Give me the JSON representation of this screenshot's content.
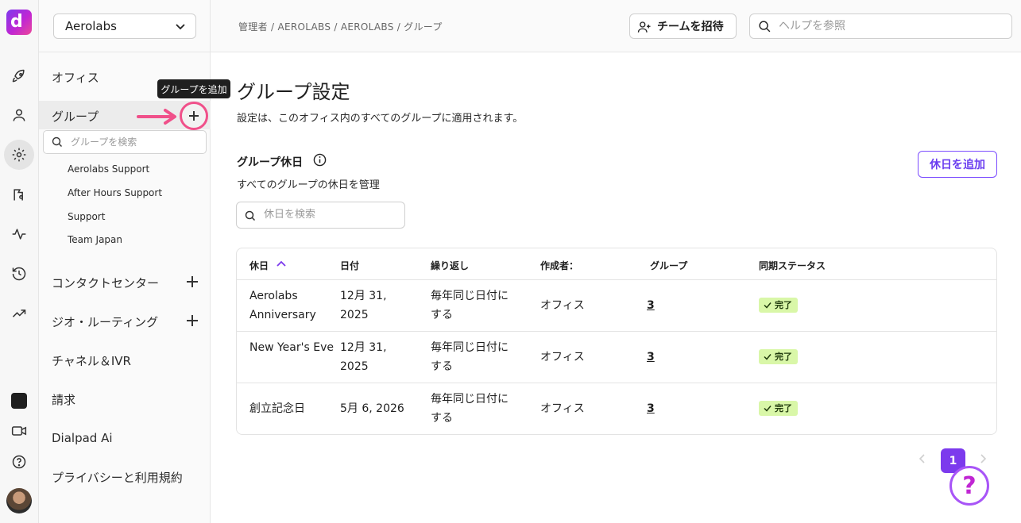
{
  "rail": {
    "logo_text": "d",
    "icons": [
      "rocket-icon",
      "person-icon",
      "gear-icon",
      "routing-icon",
      "activity-icon",
      "history-icon",
      "trending-icon",
      "dialpad-icon",
      "video-icon",
      "question-icon"
    ]
  },
  "sidebar": {
    "org": "Aerolabs",
    "items": {
      "office": "オフィス",
      "groups": "グループ",
      "contact_center": "コンタクトセンター",
      "geo_routing": "ジオ・ルーティング",
      "channels_ivr": "チャネル＆IVR",
      "billing": "請求",
      "dialpad_ai": "Dialpad Ai",
      "privacy": "プライバシーと利用規約"
    },
    "group_search_placeholder": "グループを検索",
    "groups_list": [
      "Aerolabs Support",
      "After Hours Support",
      "Support",
      "Team Japan"
    ],
    "tooltip": "グループを追加"
  },
  "topbar": {
    "breadcrumb": "管理者 / AEROLABS / AEROLABS / グループ",
    "invite_label": "チームを招待",
    "help_placeholder": "ヘルプを参照"
  },
  "main": {
    "title": "グループ設定",
    "subtitle": "設定は、このオフィス内のすべてのグループに適用されます。",
    "section_title": "グループ休日",
    "section_sub": "すべてのグループの休日を管理",
    "add_holiday": "休日を追加",
    "holiday_search_placeholder": "休日を検索",
    "table": {
      "headers": [
        "休日",
        "日付",
        "繰り返し",
        "作成者：",
        "グループ",
        "同期ステータス"
      ],
      "rows": [
        {
          "holiday": "Aerolabs Anniversary",
          "date": "12月 31, 2025",
          "repeat": "毎年同じ日付にする",
          "creator": "オフィス",
          "groups": "3",
          "status": "完了"
        },
        {
          "holiday": "New Year's Eve",
          "date": "12月 31, 2025",
          "repeat": "毎年同じ日付にする",
          "creator": "オフィス",
          "groups": "3",
          "status": "完了"
        },
        {
          "holiday": "創立記念日",
          "date": "5月 6, 2026",
          "repeat": "毎年同じ日付にする",
          "creator": "オフィス",
          "groups": "3",
          "status": "完了"
        }
      ]
    },
    "page": "1",
    "help_fab": "?"
  },
  "colors": {
    "accent": "#7c3aed",
    "highlight": "#f0508a",
    "badge_bg": "#d9f7a8"
  }
}
